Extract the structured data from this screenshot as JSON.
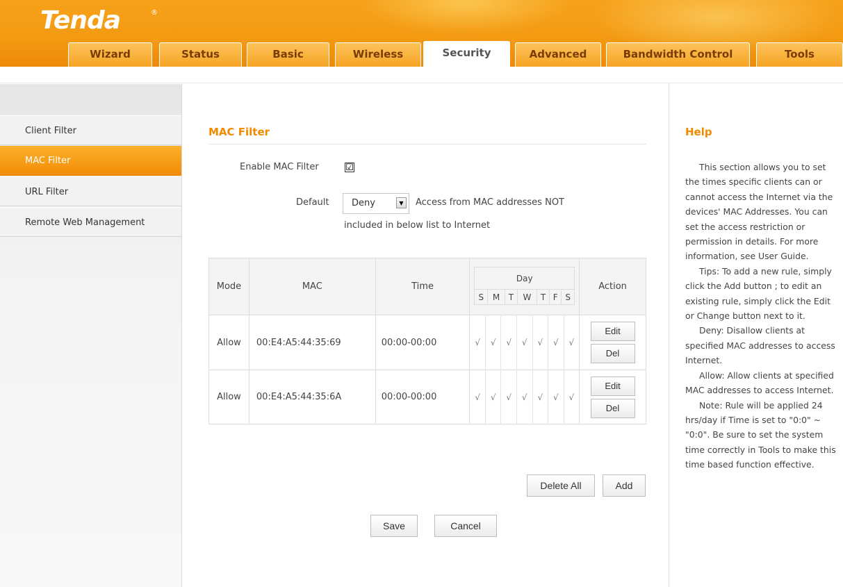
{
  "brand": {
    "logo": "Tenda",
    "reg": "®"
  },
  "tabs": [
    {
      "label": "Wizard"
    },
    {
      "label": "Status"
    },
    {
      "label": "Basic"
    },
    {
      "label": "Wireless"
    },
    {
      "label": "Security"
    },
    {
      "label": "Advanced"
    },
    {
      "label": "Bandwidth Control"
    },
    {
      "label": "Tools"
    }
  ],
  "active_tab": "Security",
  "sidebar": {
    "items": [
      {
        "label": "Client Filter"
      },
      {
        "label": "MAC Filter"
      },
      {
        "label": "URL Filter"
      },
      {
        "label": "Remote Web Management"
      }
    ],
    "active": "MAC Filter"
  },
  "main": {
    "title": "MAC Filter",
    "enable_label": "Enable MAC Filter",
    "enable_checked": "☑",
    "default_label": "Default",
    "default_value": "Deny",
    "default_arrow": "▼",
    "default_desc_1": "Access from MAC addresses NOT",
    "default_desc_2": "included in below list to Internet",
    "table": {
      "headers": {
        "mode": "Mode",
        "mac": "MAC",
        "time": "Time",
        "day": "Day",
        "action": "Action"
      },
      "days": [
        "S",
        "M",
        "T",
        "W",
        "T",
        "F",
        "S"
      ],
      "rows": [
        {
          "mode": "Allow",
          "mac": "00:E4:A5:44:35:69",
          "time": "00:00-00:00",
          "checks": [
            "√",
            "√",
            "√",
            "√",
            "√",
            "√",
            "√"
          ],
          "edit": "Edit",
          "del": "Del"
        },
        {
          "mode": "Allow",
          "mac": "00:E4:A5:44:35:6A",
          "time": "00:00-00:00",
          "checks": [
            "√",
            "√",
            "√",
            "√",
            "√",
            "√",
            "√"
          ],
          "edit": "Edit",
          "del": "Del"
        }
      ]
    },
    "delete_all": "Delete All",
    "add": "Add",
    "save": "Save",
    "cancel": "Cancel"
  },
  "help": {
    "title": "Help",
    "paragraphs": [
      "This section allows you to set the times specific clients can or cannot access the Internet via the devices' MAC Addresses. You can set the access restriction or permission in details. For more information, see User Guide.",
      "Tips: To add a new rule, simply click the Add button ; to edit an existing rule, simply click the Edit or Change button next to it.",
      "Deny: Disallow clients at specified MAC addresses to access Internet.",
      "Allow: Allow clients at specified MAC addresses to access Internet.",
      "Note: Rule will be applied 24 hrs/day if Time is set to \"0:0\" ~ \"0:0\". Be sure to set the system time correctly in Tools to make this time based function effective."
    ]
  },
  "colors": {
    "accent": "#f28a00",
    "header": "#f39a12",
    "active_side": "#f5a01c"
  }
}
